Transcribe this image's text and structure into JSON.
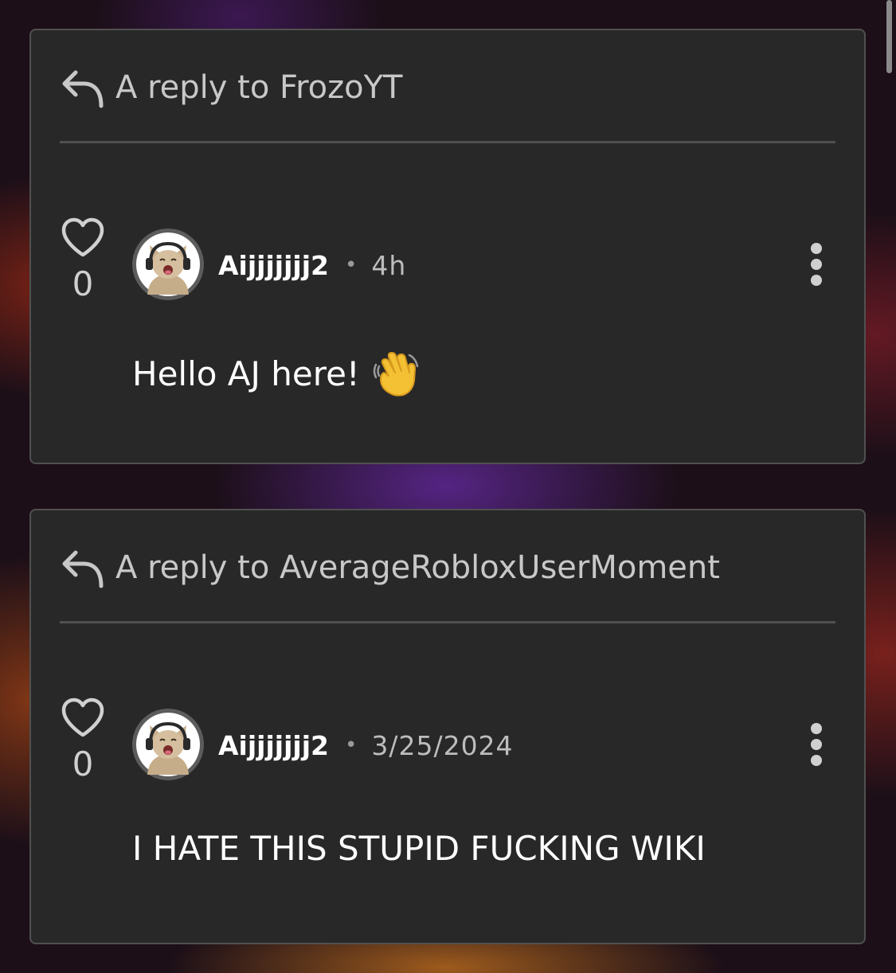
{
  "comments": [
    {
      "reply_to_text": "A reply to FrozoYT",
      "likes": "0",
      "username": "Aijjjjjjj2",
      "separator": "•",
      "timestamp": "4h",
      "body": "Hello AJ here!",
      "body_emoji": "waving-hand-icon"
    },
    {
      "reply_to_text": "A reply to AverageRobloxUserMoment",
      "likes": "0",
      "username": "Aijjjjjjj2",
      "separator": "•",
      "timestamp": "3/25/2024",
      "body": "I HATE THIS STUPID FUCKING WIKI",
      "body_emoji": ""
    }
  ],
  "icons": {
    "reply": "reply-arrow-icon",
    "like": "heart-icon",
    "menu": "more-vertical-icon",
    "avatar": "cat-with-headphones-avatar"
  },
  "colors": {
    "card_background": "#282828",
    "card_border": "#505050",
    "text_primary": "#ffffff",
    "text_secondary": "#c8c8c8"
  }
}
